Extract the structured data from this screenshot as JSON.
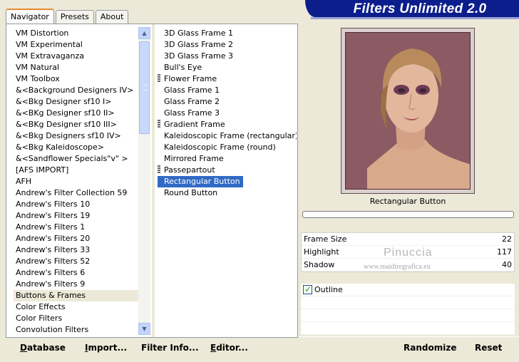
{
  "tabs": [
    {
      "label": "Navigator",
      "active": true
    },
    {
      "label": "Presets",
      "active": false
    },
    {
      "label": "About",
      "active": false
    }
  ],
  "app_title": "Filters Unlimited 2.0",
  "categories": [
    "VM Distortion",
    "VM Experimental",
    "VM Extravaganza",
    "VM Natural",
    "VM Toolbox",
    "&<Background Designers IV>",
    "&<Bkg Designer sf10 I>",
    "&<BKg Designer sf10 II>",
    "&<BKg Designer sf10 III>",
    "&<Bkg Designers sf10 IV>",
    "&<Bkg Kaleidoscope>",
    "&<Sandflower Specials\"v\" >",
    "[AFS IMPORT]",
    "AFH",
    "Andrew's Filter Collection 59",
    "Andrew's Filters 10",
    "Andrew's Filters 19",
    "Andrew's Filters 1",
    "Andrew's Filters 20",
    "Andrew's Filters 33",
    "Andrew's Filters 52",
    "Andrew's Filters 6",
    "Andrew's Filters 9",
    "Buttons & Frames",
    "Color Effects",
    "Color Filters",
    "Convolution Filters"
  ],
  "selected_category": "Buttons & Frames",
  "filters": [
    {
      "label": "3D Glass Frame 1",
      "group": false
    },
    {
      "label": "3D Glass Frame 2",
      "group": false
    },
    {
      "label": "3D Glass Frame 3",
      "group": false
    },
    {
      "label": "Bull's Eye",
      "group": false
    },
    {
      "label": "Flower Frame",
      "group": true
    },
    {
      "label": "Glass Frame 1",
      "group": false
    },
    {
      "label": "Glass Frame 2",
      "group": false
    },
    {
      "label": "Glass Frame 3",
      "group": false
    },
    {
      "label": "Gradient Frame",
      "group": true
    },
    {
      "label": "Kaleidoscopic Frame (rectangular)",
      "group": false
    },
    {
      "label": "Kaleidoscopic Frame (round)",
      "group": false
    },
    {
      "label": "Mirrored Frame",
      "group": false
    },
    {
      "label": "Passepartout",
      "group": true
    },
    {
      "label": "Rectangular Button",
      "group": false
    },
    {
      "label": "Round Button",
      "group": false
    }
  ],
  "selected_filter": "Rectangular Button",
  "preview_filter_name": "Rectangular Button",
  "params": [
    {
      "label": "Frame Size",
      "value": "22"
    },
    {
      "label": "Highlight",
      "value": "117"
    },
    {
      "label": "Shadow",
      "value": "40"
    }
  ],
  "watermark": {
    "name": "Pinuccia",
    "site": "www.maidiregrafica.eu"
  },
  "outline": {
    "label": "Outline",
    "checked": true
  },
  "buttons": {
    "database": "Database",
    "import": "Import...",
    "filter_info": "Filter Info...",
    "editor": "Editor...",
    "randomize": "Randomize",
    "reset": "Reset"
  },
  "colors": {
    "banner": "#0c1e8c",
    "selection": "#316ac5",
    "window": "#ece9d8"
  }
}
